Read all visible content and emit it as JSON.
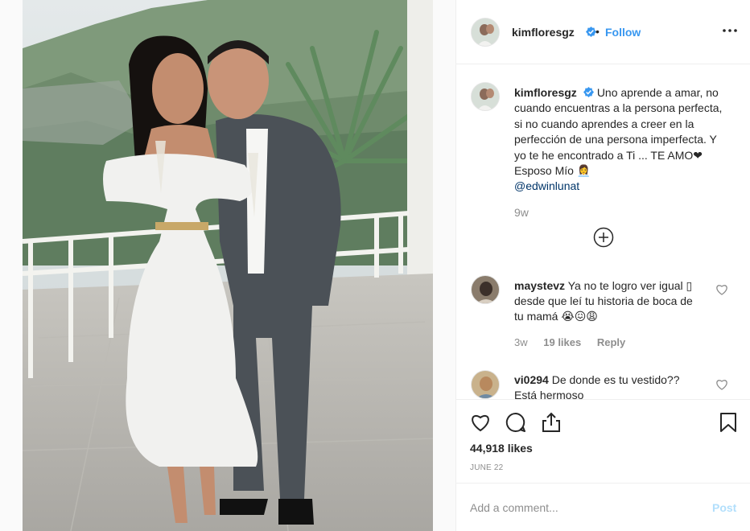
{
  "post": {
    "username": "kimfloresgz",
    "separator": "•",
    "follow_label": "Follow",
    "more_icon": "ellipsis-icon",
    "photo_alt": "Couple in white dress and gray suit holding champagne glasses on a terrace"
  },
  "caption": {
    "username": "kimfloresgz",
    "text": "Uno aprende a amar, no cuando encuentras a la persona perfecta, si no cuando aprendes a creer en la perfección de una persona imperfecta. Y yo te he encontrado a Ti ... TE AMO❤Esposo Mío 👩‍💼",
    "mention": "@edwinlunat",
    "time": "9w"
  },
  "comments": [
    {
      "username": "maystevz",
      "text": "Ya no te logro ver igual ▯ desde que leí tu historia de boca de tu mamá 😭😖😩",
      "time": "3w",
      "likes": "19 likes",
      "reply": "Reply"
    },
    {
      "username": "vi0294",
      "text": "De donde es tu vestido?? Está hermoso"
    }
  ],
  "footer": {
    "likes": "44,918 likes",
    "date": "JUNE 22"
  },
  "add_comment": {
    "placeholder": "Add a comment...",
    "post_label": "Post"
  },
  "colors": {
    "link_blue": "#3897f0",
    "verified_blue": "#3897f0",
    "muted": "#8e8e8e",
    "post_disabled": "#b2dffc"
  }
}
